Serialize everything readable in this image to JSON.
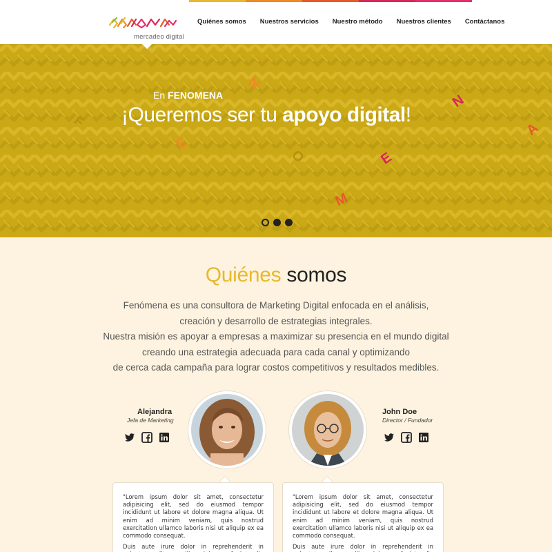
{
  "colors": {
    "hero_bg": "#cba916",
    "accent_yellow": "#e8b92c",
    "page_bg": "#fdf3e0",
    "stripe_colors": [
      "#e8b92c",
      "#f08a24",
      "#e55a2b",
      "#d9265b",
      "#e62d6f"
    ]
  },
  "header": {
    "logo_text": "FENOMENA",
    "logo_sub": "mercadeo digital",
    "nav": [
      {
        "label": "Quiénes somos"
      },
      {
        "label": "Nuestros servicios"
      },
      {
        "label": "Nuestro método"
      },
      {
        "label": "Nuestros clientes"
      },
      {
        "label": "Contáctanos"
      }
    ]
  },
  "hero": {
    "sub_prefix": "En ",
    "sub_brand": "FENOMENA",
    "title_normal": "¡Queremos ser tu ",
    "title_bold": "apoyo digital",
    "title_end": "!",
    "floating_letters": [
      "F",
      "E",
      "N",
      "O",
      "M",
      "E",
      "N",
      "A"
    ],
    "slides": 3,
    "active_slide": 0
  },
  "about": {
    "title_highlight": "Quiénes",
    "title_rest": " somos",
    "lines": [
      "Fenómena es una consultora de Marketing Digital enfocada en el análisis,",
      "creación y desarrollo de estrategias integrales.",
      "Nuestra misión es apoyar a empresas a maximizar su presencia en el mundo digital",
      "creando una estrategia adecuada para cada canal y optimizando",
      "de cerca cada campaña para lograr costos competitivos y resultados medibles."
    ]
  },
  "team": [
    {
      "name": "Alejandra",
      "role": "Jefa de Marketing",
      "icons": [
        "twitter-icon",
        "facebook-icon",
        "linkedin-icon"
      ],
      "quote_p1": "\"Lorem ipsum dolor sit amet, consectetur adipisicing elit, sed do eiusmod tempor incididunt ut labore et dolore magna aliqua. Ut enim ad minim veniam, quis nostrud exercitation ullamco laboris nisi ut aliquip ex ea commodo consequat.",
      "quote_p2": "Duis aute irure dolor in reprehenderit in voluptate velit esse cillum dolore eu fugiat nulla pariatur. Excepteur sint occaecat cupidatat non proident,"
    },
    {
      "name": "John Doe",
      "role": "Director / Fundador",
      "icons": [
        "twitter-icon",
        "facebook-icon",
        "linkedin-icon"
      ],
      "quote_p1": "\"Lorem ipsum dolor sit amet, consectetur adipisicing elit, sed do eiusmod tempor incididunt ut labore et dolore magna aliqua. Ut enim ad minim veniam, quis nostrud exercitation ullamco laboris nisi ut aliquip ex ea commodo consequat.",
      "quote_p2": "Duis aute irure dolor in reprehenderit in voluptate velit esse cillum dolore eu fugiat nulla pariatur. Excepteur sint occaecat cupidatat non proident,"
    }
  ]
}
